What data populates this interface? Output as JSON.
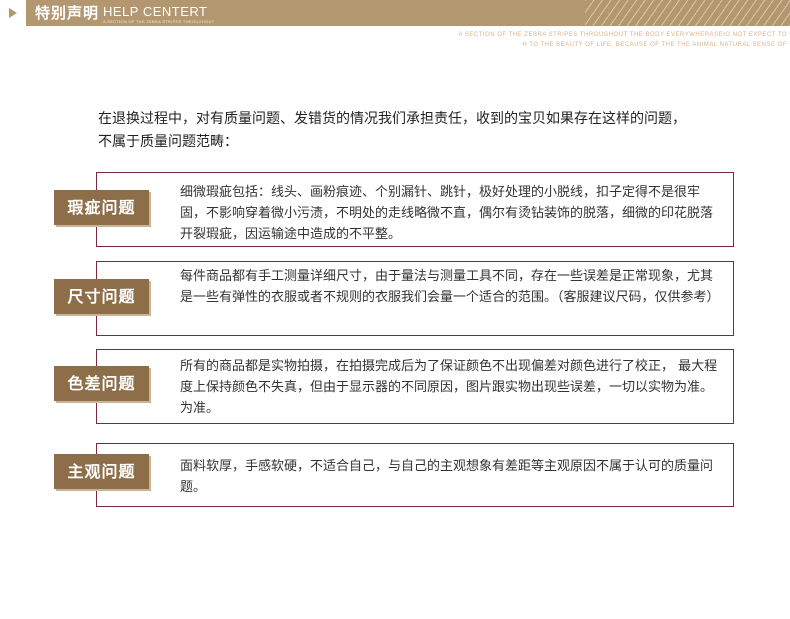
{
  "header": {
    "title": "特别声明",
    "subtitle_en": "HELP CENTERT",
    "subtitle_small": "A SECTION OF THE ZEBRA STRIPES THROUGHOUT",
    "tagline_line1": "A SECTION OF THE ZEBRA STRIPES THROUGHOUT THE BODY EVERYWHERASEIO NOT EXPECT TO",
    "tagline_line2": "H TO THE BEAUTY OF LIFE, BECAUSE OF THE THE ANIMAL NATURAL SENSE OF"
  },
  "intro": {
    "line1": "在退换过程中，对有质量问题、发错货的情况我们承担责任，收到的宝贝如果存在这样的问题，",
    "line2": "不属于质量问题范畴："
  },
  "items": [
    {
      "label": "瑕疵问题",
      "text": "细微瑕疵包括：线头、画粉痕迹、个别漏针、跳针，极好处理的小脱线，扣子定得不是很牢固，不影响穿着微小污渍，不明处的走线略微不直，偶尔有烫钻装饰的脱落，细微的印花脱落开裂瑕疵，因运输途中造成的不平整。"
    },
    {
      "label": "尺寸问题",
      "text": "每件商品都有手工测量详细尺寸，由于量法与测量工具不同，存在一些误差是正常现象，尤其是一些有弹性的衣服或者不规则的衣服我们会量一个适合的范围。（客服建议尺码，仅供参考）"
    },
    {
      "label": "色差问题",
      "text": "所有的商品都是实物拍摄，在拍摄完成后为了保证颜色不出现偏差对颜色进行了校正，  最大程度上保持颜色不失真，但由于显示器的不同原因，图片跟实物出现些误差，一切以实物为准。为准。"
    },
    {
      "label": "主观问题",
      "text": "面料软厚，手感软硬，不适合自己，与自己的主观想象有差距等主观原因不属于认可的质量问题。"
    }
  ],
  "colors": {
    "header_bar": "#b39770",
    "label_bg": "#8d6e48",
    "box_border": "#7a2a3a"
  }
}
